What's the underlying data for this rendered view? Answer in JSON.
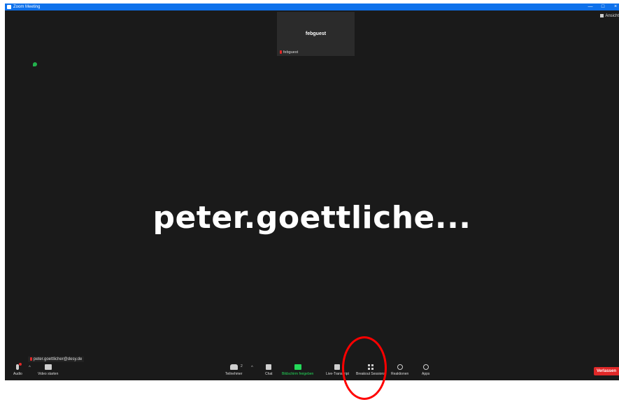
{
  "window": {
    "title": "Zoom Meeting"
  },
  "titlebar_controls": {
    "minimize": "—",
    "restore": "□",
    "close": "×"
  },
  "view_button": {
    "label": "Ansicht"
  },
  "thumbnail": {
    "display_name": "febguest",
    "label": "febguest"
  },
  "main_video": {
    "name": "peter.goettliche..."
  },
  "self_view": {
    "label": "peter.goettlicher@desy.de"
  },
  "toolbar": {
    "audio": "Audio",
    "video": "Video starten",
    "participants": "Teilnehmer",
    "participants_count": "2",
    "chat": "Chat",
    "share": "Bildschirm freigeben",
    "transcript": "Live-Transkript",
    "breakout": "Breakout Sessions",
    "reactions": "Reaktionen",
    "apps": "Apps",
    "leave": "Verlassen"
  },
  "colors": {
    "accent": "#0e71eb",
    "share_green": "#23d959",
    "leave_red": "#e02828",
    "annotation": "#ff0000"
  }
}
